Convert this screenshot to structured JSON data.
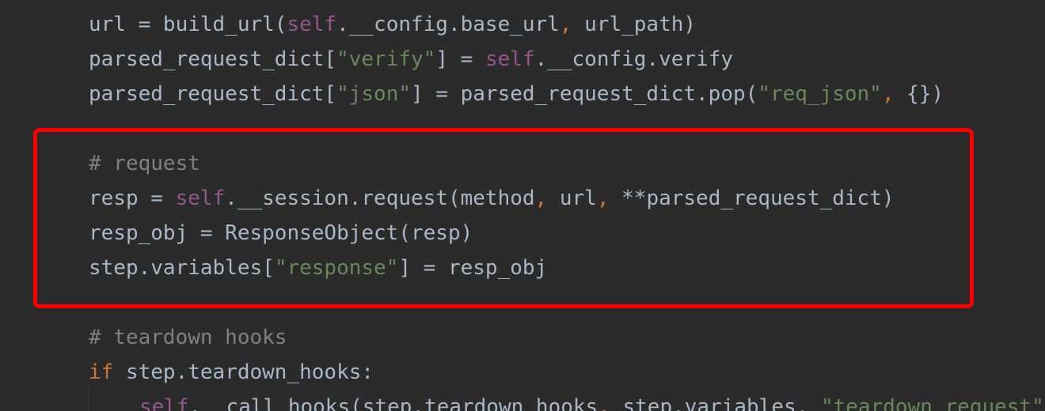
{
  "code": {
    "line1": {
      "a": "url = build_url(",
      "self": "self",
      "b": ".__config.base_url",
      "comma": ",",
      "c": " url_path)"
    },
    "line2": {
      "a": "parsed_request_dict[",
      "str": "\"verify\"",
      "b": "] = ",
      "self": "self",
      "c": ".__config.verify"
    },
    "line3": {
      "a": "parsed_request_dict[",
      "str": "\"json\"",
      "b": "] = parsed_request_dict.pop(",
      "str2": "\"req_json\"",
      "comma": ",",
      "c": " {})"
    },
    "line4": {
      "comment": "# request"
    },
    "line5": {
      "a": "resp = ",
      "self": "self",
      "b": ".__session.request(method",
      "comma1": ",",
      "c": " url",
      "comma2": ",",
      "d": " **parsed_request_dict)"
    },
    "line6": {
      "a": "resp_obj = ResponseObject(resp)"
    },
    "line7": {
      "a": "step.variables[",
      "str": "\"response\"",
      "b": "] = resp_obj"
    },
    "line8": {
      "comment": "# teardown hooks"
    },
    "line9": {
      "kw": "if",
      "a": " step.teardown_hooks:"
    },
    "line10": {
      "self": "self",
      "a": ".__call_hooks(step.teardown_hooks",
      "comma1": ",",
      "b": " step.variables",
      "comma2": ",",
      "str": "\"teardown_request\""
    }
  },
  "colors": {
    "background": "#2b2b2b",
    "default_text": "#a9b7c6",
    "self_keyword": "#94558d",
    "string": "#6a8759",
    "keyword": "#cc7832",
    "comment": "#808080",
    "highlight_border": "#ff0000"
  }
}
